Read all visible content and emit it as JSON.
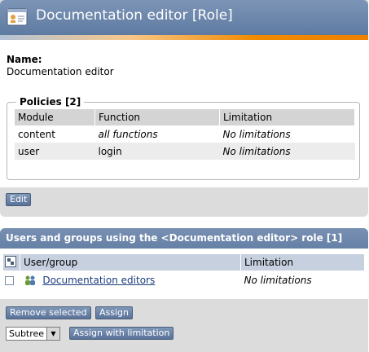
{
  "role": {
    "title": "Documentation editor [Role]",
    "name_label": "Name:",
    "name_value": "Documentation editor",
    "edit_label": "Edit"
  },
  "policies": {
    "legend": "Policies [2]",
    "columns": [
      "Module",
      "Function",
      "Limitation"
    ],
    "rows": [
      {
        "module": "content",
        "function": "all functions",
        "limitation": "No limitations"
      },
      {
        "module": "user",
        "function": "login",
        "limitation": "No limitations"
      }
    ]
  },
  "users": {
    "title": "Users and groups using the <Documentation editor> role [1]",
    "columns": [
      "User/group",
      "Limitation"
    ],
    "rows": [
      {
        "name": "Documentation editors",
        "limitation": "No limitations"
      }
    ],
    "remove_label": "Remove selected",
    "assign_label": "Assign",
    "subtree_value": "Subtree",
    "assign_limitation_label": "Assign with limitation"
  },
  "icons": {
    "role_icon": "role-card-icon",
    "toggle_icon": "toggle-selection-icon",
    "group_icon": "user-group-icon",
    "dropdown_icon": "chevron-down-icon"
  },
  "colors": {
    "header_blue": "#6a84aa",
    "accent_orange": "#f08a00",
    "link": "#1a3b7c"
  }
}
